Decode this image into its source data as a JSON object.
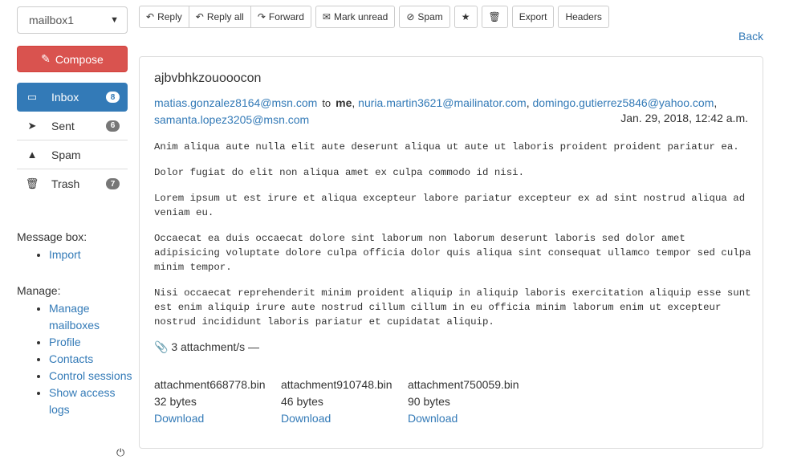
{
  "sidebar": {
    "mailbox_select": "mailbox1",
    "compose_label": "Compose",
    "folders": [
      {
        "label": "Inbox",
        "count": "8",
        "icon": "inbox-icon"
      },
      {
        "label": "Sent",
        "count": "6",
        "icon": "paper-plane-icon"
      },
      {
        "label": "Spam",
        "count": "",
        "icon": "warning-icon"
      },
      {
        "label": "Trash",
        "count": "7",
        "icon": "trash-icon"
      }
    ],
    "message_box_heading": "Message box:",
    "import_label": "Import",
    "manage_heading": "Manage:",
    "manage_links": [
      "Manage mailboxes",
      "Profile",
      "Contacts",
      "Control sessions",
      "Show access logs"
    ]
  },
  "toolbar": {
    "reply": "Reply",
    "reply_all": "Reply all",
    "forward": "Forward",
    "mark_unread": "Mark unread",
    "spam": "Spam",
    "export": "Export",
    "headers": "Headers",
    "back": "Back"
  },
  "message": {
    "subject": "ajbvbhkzouooocon",
    "from": "matias.gonzalez8164@msn.com",
    "to_word": "to",
    "me": "me",
    "cc": [
      "nuria.martin3621@mailinator.com",
      "domingo.gutierrez5846@yahoo.com",
      "samanta.lopez3205@msn.com"
    ],
    "date": "Jan. 29, 2018, 12:42 a.m.",
    "body": [
      "Anim aliqua aute nulla elit aute deserunt aliqua ut aute ut laboris proident proident pariatur ea.",
      "Dolor fugiat do elit non aliqua amet ex culpa commodo id nisi.",
      "Lorem ipsum ut est irure et aliqua excepteur labore pariatur excepteur ex ad sint nostrud aliqua ad veniam eu.",
      "Occaecat ea duis occaecat dolore sint laborum non laborum deserunt laboris sed dolor amet adipisicing voluptate dolore culpa officia dolor quis aliqua sint consequat ullamco tempor sed culpa minim tempor.",
      "Nisi occaecat reprehenderit minim proident aliquip in aliquip laboris exercitation aliquip esse sunt est enim aliquip irure aute nostrud cillum cillum in eu officia minim laborum enim ut excepteur nostrud incididunt laboris pariatur et cupidatat aliquip."
    ],
    "attachments_label": "3 attachment/s —",
    "attachments": [
      {
        "name": "attachment668778.bin",
        "size": "32 bytes",
        "action": "Download"
      },
      {
        "name": "attachment910748.bin",
        "size": "46 bytes",
        "action": "Download"
      },
      {
        "name": "attachment750059.bin",
        "size": "90 bytes",
        "action": "Download"
      }
    ]
  },
  "colors": {
    "accent": "#337ab7",
    "compose": "#d9534f",
    "link": "#1a0dab"
  }
}
